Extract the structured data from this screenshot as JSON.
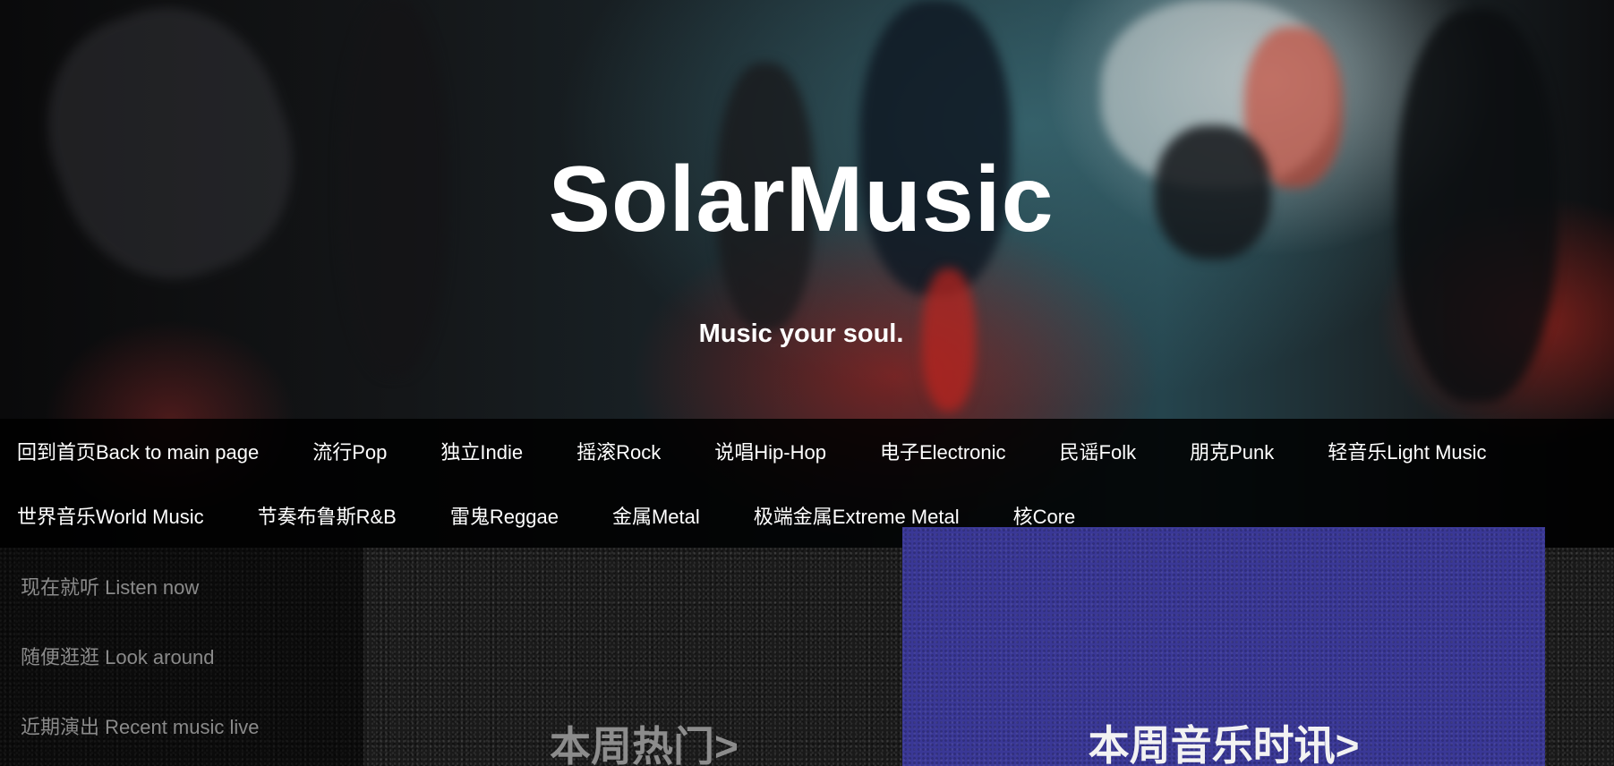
{
  "site": {
    "title": "SolarMusic",
    "tagline": "Music your soul."
  },
  "nav": {
    "row1": [
      "回到首页Back to main page",
      "流行Pop",
      "独立Indie",
      "摇滚Rock",
      "说唱Hip-Hop",
      "电子Electronic",
      "民谣Folk",
      "朋克Punk",
      "轻音乐Light Music"
    ],
    "row2": [
      "世界音乐World Music",
      "节奏布鲁斯R&B",
      "雷鬼Reggae",
      "金属Metal",
      "极端金属Extreme Metal",
      "核Core"
    ]
  },
  "side_menu": {
    "items": [
      "现在就听 Listen now",
      "随便逛逛 Look around",
      "近期演出 Recent music live"
    ]
  },
  "sections": {
    "hot_this_week": "本周热门>",
    "music_news_this_week": "本周音乐时讯>"
  },
  "colors": {
    "news_panel": "#3a3896",
    "nav_background": "#000000",
    "side_menu_text": "#8a8a8a"
  }
}
